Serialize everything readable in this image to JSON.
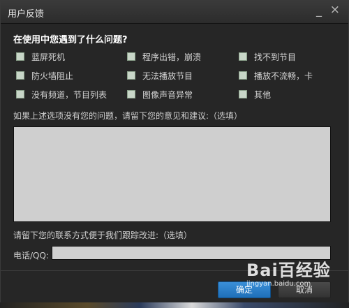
{
  "window": {
    "title": "用户反馈"
  },
  "heading": "在使用中您遇到了什么问题?",
  "options": [
    {
      "label": "蓝屏死机"
    },
    {
      "label": "程序出错，崩溃"
    },
    {
      "label": "找不到节目"
    },
    {
      "label": "防火墙阻止"
    },
    {
      "label": "无法播放节目"
    },
    {
      "label": "播放不流畅，卡"
    },
    {
      "label": "没有频道，节目列表"
    },
    {
      "label": "图像声音异常"
    },
    {
      "label": "其他"
    }
  ],
  "feedback_hint": "如果上述选项没有您的问题，请留下您的意见和建议:（选填）",
  "feedback_value": "",
  "contact_hint": "请留下您的联系方式便于我们跟踪改进:（选填）",
  "phone_label": "电话/QQ:",
  "phone_value": "",
  "buttons": {
    "ok": "确定",
    "cancel": "取消"
  },
  "watermark": {
    "logo": "Bai百经验",
    "site": "jingyan.baidu.com"
  }
}
